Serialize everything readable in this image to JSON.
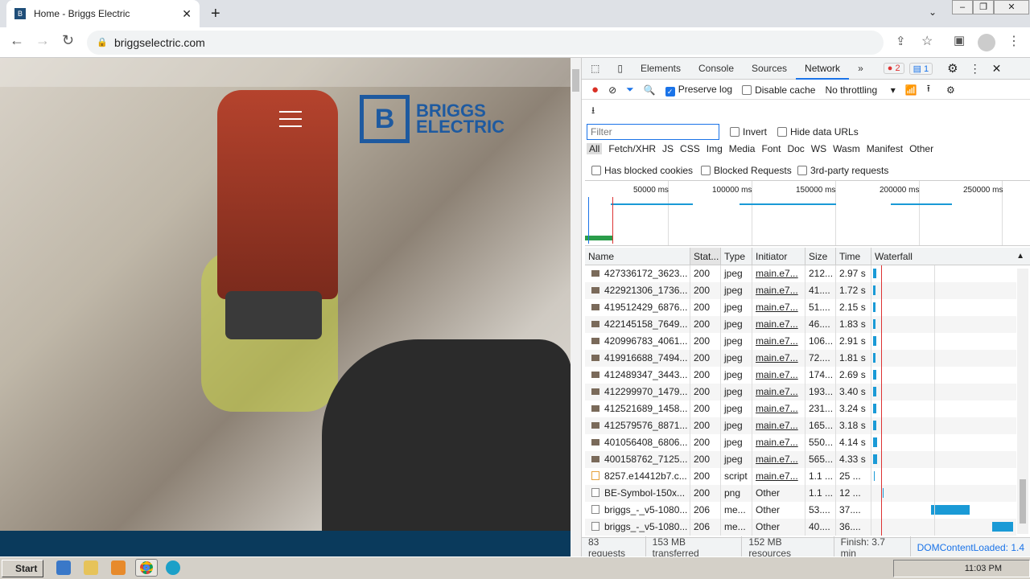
{
  "browser": {
    "tab_title": "Home - Briggs Electric",
    "url": "briggselectric.com"
  },
  "page": {
    "logo_text_1": "BRIGGS",
    "logo_text_2": "ELECTRIC",
    "logo_mark": "B"
  },
  "devtools": {
    "tabs": [
      "Elements",
      "Console",
      "Sources",
      "Network"
    ],
    "more": "»",
    "errors": "2",
    "messages": "1",
    "preserve_log": "Preserve log",
    "disable_cache": "Disable cache",
    "throttling": "No throttling",
    "filter_placeholder": "Filter",
    "invert": "Invert",
    "hide_data_urls": "Hide data URLs",
    "types": [
      "All",
      "Fetch/XHR",
      "JS",
      "CSS",
      "Img",
      "Media",
      "Font",
      "Doc",
      "WS",
      "Wasm",
      "Manifest",
      "Other"
    ],
    "has_blocked_cookies": "Has blocked cookies",
    "blocked_requests": "Blocked Requests",
    "third_party": "3rd-party requests",
    "overview_ticks": [
      "50000 ms",
      "100000 ms",
      "150000 ms",
      "200000 ms",
      "250000 ms"
    ],
    "columns": [
      "Name",
      "Stat...",
      "Type",
      "Initiator",
      "Size",
      "Time",
      "Waterfall"
    ],
    "rows": [
      {
        "name": "427336172_3623...",
        "status": "200",
        "type": "jpeg",
        "initiator": "main.e7...",
        "size": "212...",
        "time": "2.97 s",
        "icon": "img"
      },
      {
        "name": "422921306_1736...",
        "status": "200",
        "type": "jpeg",
        "initiator": "main.e7...",
        "size": "41....",
        "time": "1.72 s",
        "icon": "img"
      },
      {
        "name": "419512429_6876...",
        "status": "200",
        "type": "jpeg",
        "initiator": "main.e7...",
        "size": "51....",
        "time": "2.15 s",
        "icon": "img"
      },
      {
        "name": "422145158_7649...",
        "status": "200",
        "type": "jpeg",
        "initiator": "main.e7...",
        "size": "46....",
        "time": "1.83 s",
        "icon": "img"
      },
      {
        "name": "420996783_4061...",
        "status": "200",
        "type": "jpeg",
        "initiator": "main.e7...",
        "size": "106...",
        "time": "2.91 s",
        "icon": "img"
      },
      {
        "name": "419916688_7494...",
        "status": "200",
        "type": "jpeg",
        "initiator": "main.e7...",
        "size": "72....",
        "time": "1.81 s",
        "icon": "img"
      },
      {
        "name": "412489347_3443...",
        "status": "200",
        "type": "jpeg",
        "initiator": "main.e7...",
        "size": "174...",
        "time": "2.69 s",
        "icon": "img"
      },
      {
        "name": "412299970_1479...",
        "status": "200",
        "type": "jpeg",
        "initiator": "main.e7...",
        "size": "193...",
        "time": "3.40 s",
        "icon": "img"
      },
      {
        "name": "412521689_1458...",
        "status": "200",
        "type": "jpeg",
        "initiator": "main.e7...",
        "size": "231...",
        "time": "3.24 s",
        "icon": "img"
      },
      {
        "name": "412579576_8871...",
        "status": "200",
        "type": "jpeg",
        "initiator": "main.e7...",
        "size": "165...",
        "time": "3.18 s",
        "icon": "img"
      },
      {
        "name": "401056408_6806...",
        "status": "200",
        "type": "jpeg",
        "initiator": "main.e7...",
        "size": "550...",
        "time": "4.14 s",
        "icon": "img"
      },
      {
        "name": "400158762_7125...",
        "status": "200",
        "type": "jpeg",
        "initiator": "main.e7...",
        "size": "565...",
        "time": "4.33 s",
        "icon": "img"
      },
      {
        "name": "8257.e14412b7.c...",
        "status": "200",
        "type": "script",
        "initiator": "main.e7...",
        "size": "1.1 ...",
        "time": "25 ...",
        "icon": "js"
      },
      {
        "name": "BE-Symbol-150x...",
        "status": "200",
        "type": "png",
        "initiator": "Other",
        "size": "1.1 ...",
        "time": "12 ...",
        "icon": "doc"
      },
      {
        "name": "briggs_-_v5-1080...",
        "status": "206",
        "type": "me...",
        "initiator": "Other",
        "size": "53....",
        "time": "37....",
        "icon": "doc"
      },
      {
        "name": "briggs_-_v5-1080...",
        "status": "206",
        "type": "me...",
        "initiator": "Other",
        "size": "40....",
        "time": "36....",
        "icon": "doc"
      }
    ],
    "status": {
      "requests": "83 requests",
      "transferred": "153 MB transferred",
      "resources": "152 MB resources",
      "finish": "Finish: 3.7 min",
      "dcl": "DOMContentLoaded: 1.4"
    }
  },
  "taskbar": {
    "start": "Start",
    "time": "11:03 PM"
  },
  "colors": {
    "accent": "#1a73e8",
    "brand": "#1e5aa0"
  }
}
